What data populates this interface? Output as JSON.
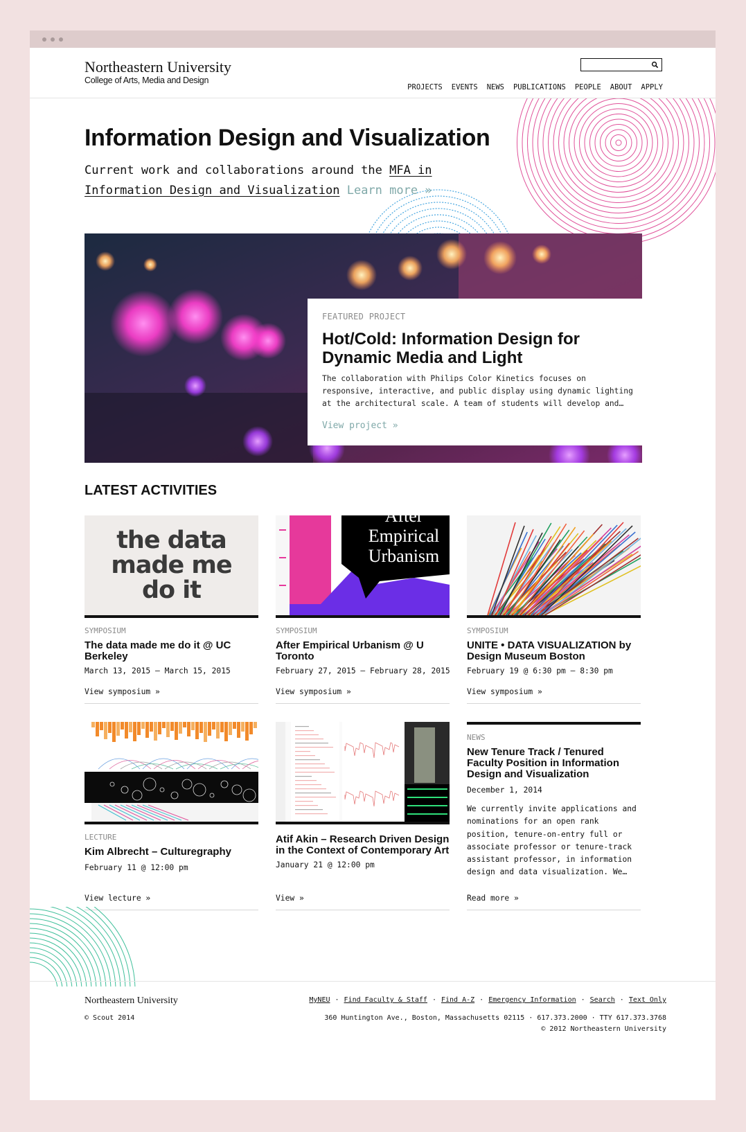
{
  "header": {
    "university": "Northeastern University",
    "college": "College of Arts, Media and Design",
    "search_placeholder": "",
    "nav": [
      "PROJECTS",
      "EVENTS",
      "NEWS",
      "PUBLICATIONS",
      "PEOPLE",
      "ABOUT",
      "APPLY"
    ]
  },
  "hero": {
    "title": "Information Design and Visualization",
    "subtitle_prefix": "Current work and collaborations around the ",
    "subtitle_link": "MFA in Information Design and Visualization",
    "learn_more": "Learn more »"
  },
  "featured": {
    "label": "FEATURED PROJECT",
    "title": "Hot/Cold: Information Design for Dynamic Media and Light",
    "description": "The collaboration with Philips Color Kinetics focuses on responsive, interactive, and public display using dynamic lighting at the architectural scale. A team of students will develop and…",
    "link": "View project »"
  },
  "activities_title": "LATEST ACTIVITIES",
  "activities": [
    {
      "category": "SYMPOSIUM",
      "title": "The data made me do it @ UC Berkeley",
      "date": "March 13, 2015 – March 15, 2015",
      "link": "View symposium »",
      "thumb_text": [
        "the data",
        "made me",
        "do it"
      ]
    },
    {
      "category": "SYMPOSIUM",
      "title": "After Empirical Urbanism @ U Toronto",
      "date": "February 27, 2015 – February 28, 2015",
      "link": "View symposium »",
      "thumb_text": [
        "After",
        "Empirical",
        "Urbanism"
      ]
    },
    {
      "category": "SYMPOSIUM",
      "title": "UNITE • DATA VISUALIZATION by Design Museum Boston",
      "date": "February 19 @ 6:30 pm – 8:30 pm",
      "link": "View symposium »"
    },
    {
      "category": "LECTURE",
      "title": "Kim Albrecht – Culturegraphy",
      "date": "February 11 @ 12:00 pm",
      "link": "View lecture »"
    },
    {
      "category": "",
      "title": "Atif Akin – Research Driven Design in the Context of Contemporary Art",
      "date": "January 21 @ 12:00 pm",
      "link": "View »"
    },
    {
      "category": "NEWS",
      "title": "New Tenure Track / Tenured Faculty Position in Information Design and Visualization",
      "date": "December 1, 2014",
      "description": "We currently invite applications and nominations for an open rank position, tenure-on-entry full or associate professor or tenure-track assistant professor, in information design and data visualization. We…",
      "link": "Read more »"
    }
  ],
  "footer": {
    "university": "Northeastern University",
    "copyright": "© Scout 2014",
    "links": [
      "MyNEU",
      "Find Faculty & Staff",
      "Find A-Z",
      "Emergency Information",
      "Search",
      "Text Only"
    ],
    "address": "360 Huntington Ave., Boston, Massachusetts 02115 · 617.373.2000 · TTY 617.373.3768",
    "nu_copyright": "© 2012 Northeastern University"
  },
  "colors": {
    "background": "#f2e1e1",
    "accent_teal": "#7fa8a8",
    "circle_pink": "#e0529a",
    "circle_blue": "#4aa8e0",
    "circle_green": "#3fbf9a"
  }
}
